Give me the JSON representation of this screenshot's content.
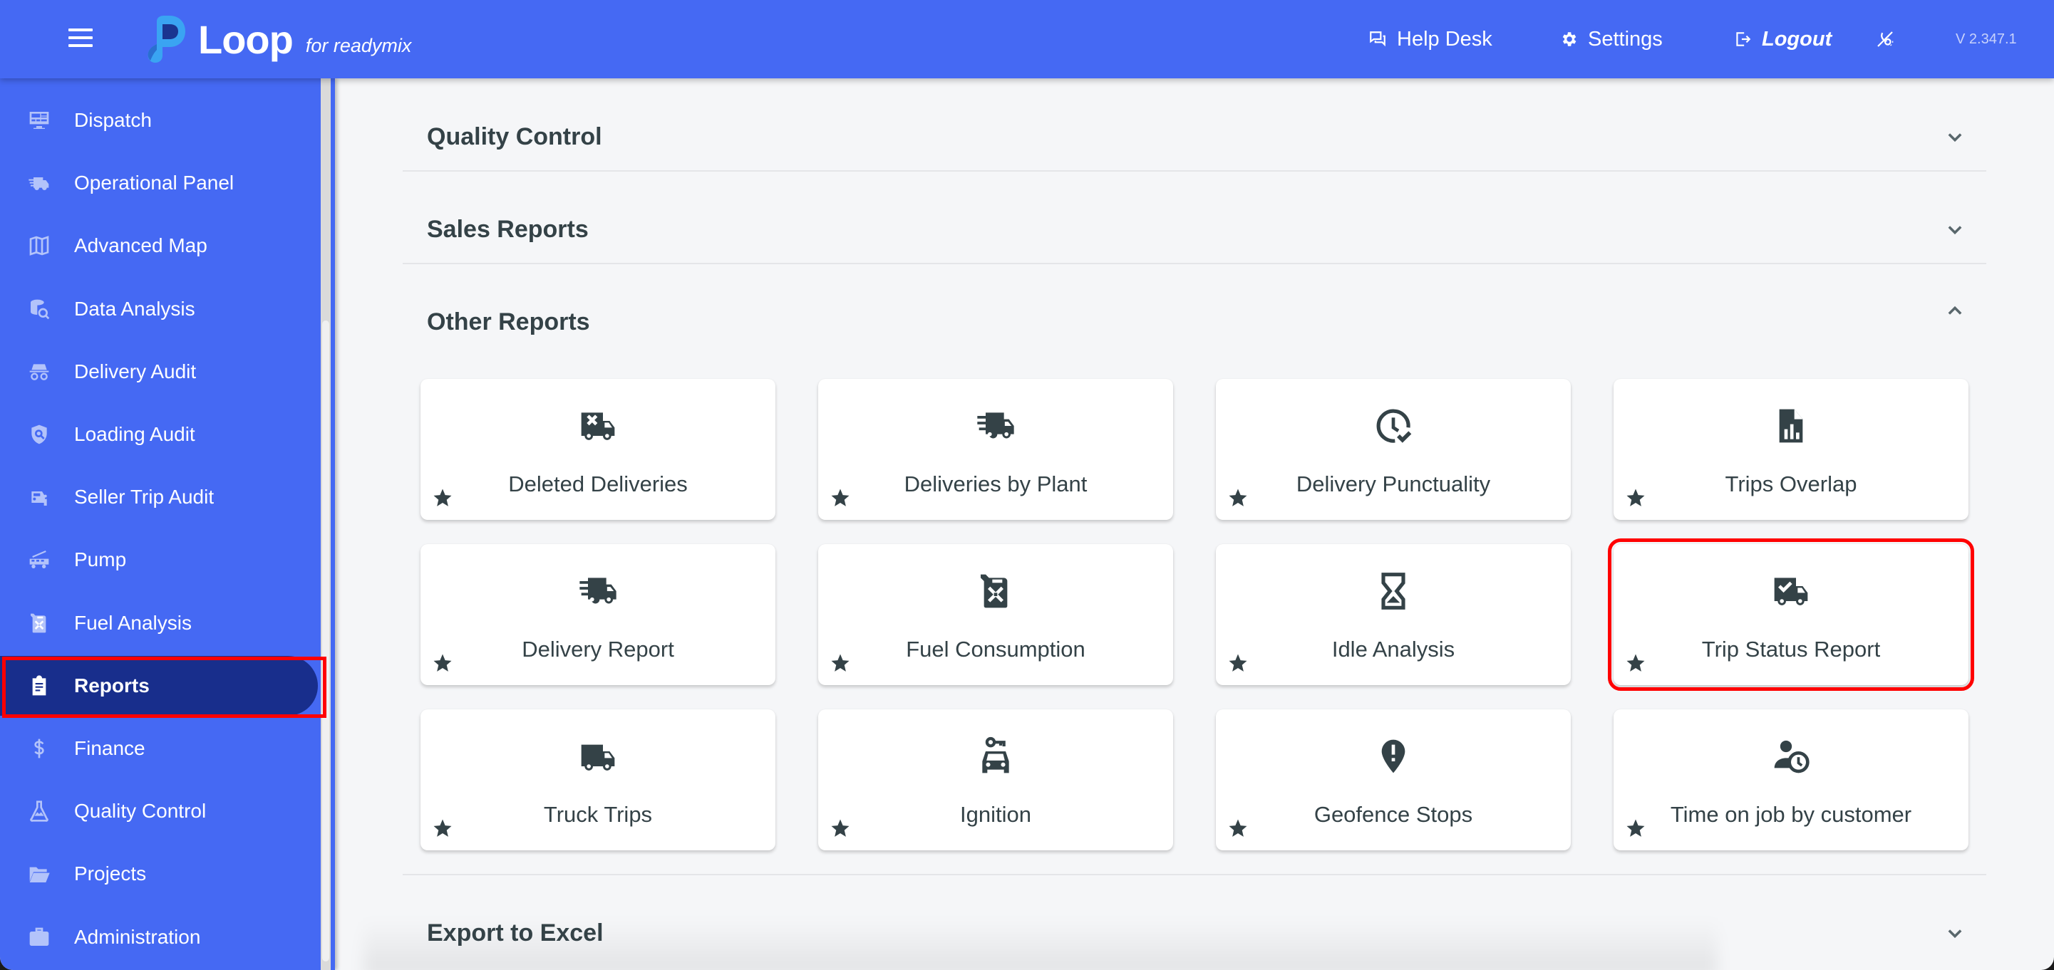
{
  "header": {
    "menu_icon": "hamburger-menu-icon",
    "logo_text": "Loop",
    "logo_subtitle": "for readymix",
    "help_desk": "Help Desk",
    "settings": "Settings",
    "logout": "Logout",
    "theme_icon": "theme-toggle-icon",
    "version": "V 2.347.1"
  },
  "sidebar": {
    "items": [
      {
        "label": "Dispatch",
        "icon": "monitor-dashboard-icon"
      },
      {
        "label": "Operational Panel",
        "icon": "fast-truck-icon"
      },
      {
        "label": "Advanced Map",
        "icon": "map-icon"
      },
      {
        "label": "Data Analysis",
        "icon": "database-search-icon"
      },
      {
        "label": "Delivery Audit",
        "icon": "incognito-icon"
      },
      {
        "label": "Loading Audit",
        "icon": "shield-search-icon"
      },
      {
        "label": "Seller Trip Audit",
        "icon": "car-info-icon"
      },
      {
        "label": "Pump",
        "icon": "pump-truck-icon"
      },
      {
        "label": "Fuel Analysis",
        "icon": "fuel-can-icon"
      },
      {
        "label": "Reports",
        "icon": "clipboard-text-icon",
        "active": true
      },
      {
        "label": "Finance",
        "icon": "dollar-icon"
      },
      {
        "label": "Quality Control",
        "icon": "flask-icon"
      },
      {
        "label": "Projects",
        "icon": "folder-open-icon"
      },
      {
        "label": "Administration",
        "icon": "briefcase-icon"
      }
    ]
  },
  "main": {
    "sections": [
      {
        "title": "Quality Control",
        "expanded": false
      },
      {
        "title": "Sales Reports",
        "expanded": false
      },
      {
        "title": "Other Reports",
        "expanded": true
      },
      {
        "title": "Export to Excel",
        "expanded": false
      }
    ],
    "cards": [
      {
        "label": "Deleted Deliveries",
        "icon": "truck-remove-icon"
      },
      {
        "label": "Deliveries by Plant",
        "icon": "truck-fast-icon"
      },
      {
        "label": "Delivery Punctuality",
        "icon": "clock-check-icon"
      },
      {
        "label": "Trips Overlap",
        "icon": "file-chart-icon"
      },
      {
        "label": "Delivery Report",
        "icon": "truck-fast-icon"
      },
      {
        "label": "Fuel Consumption",
        "icon": "fuel-can-icon"
      },
      {
        "label": "Idle Analysis",
        "icon": "hourglass-icon"
      },
      {
        "label": "Trip Status Report",
        "icon": "truck-check-icon",
        "selected": true
      },
      {
        "label": "Truck Trips",
        "icon": "truck-icon"
      },
      {
        "label": "Ignition",
        "icon": "car-key-icon"
      },
      {
        "label": "Geofence Stops",
        "icon": "map-marker-alert-icon"
      },
      {
        "label": "Time on job by customer",
        "icon": "account-clock-icon"
      }
    ]
  },
  "colors": {
    "brand": "#4569f3",
    "active_nav": "#182e8c",
    "text_dark": "#344247",
    "highlight": "#ff0000"
  }
}
